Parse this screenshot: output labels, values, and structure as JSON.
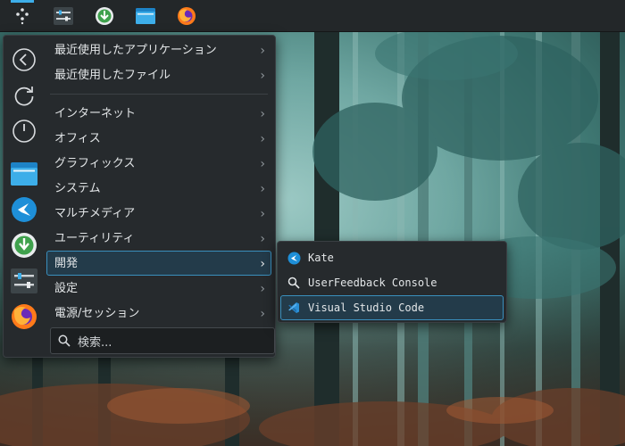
{
  "panel": {
    "buttons": [
      {
        "icon": "application-launcher-icon",
        "active": true
      },
      {
        "icon": "system-settings-icon"
      },
      {
        "icon": "download-manager-icon"
      },
      {
        "icon": "file-manager-icon"
      },
      {
        "icon": "firefox-icon"
      }
    ]
  },
  "sidebar": {
    "items": [
      {
        "icon": "back-icon"
      },
      {
        "icon": "reboot-icon"
      },
      {
        "icon": "shutdown-icon"
      },
      {
        "icon": "file-manager-icon"
      },
      {
        "icon": "kate-icon"
      },
      {
        "icon": "download-icon"
      },
      {
        "icon": "system-settings-icon"
      },
      {
        "icon": "firefox-icon"
      }
    ]
  },
  "categories": {
    "recent": [
      {
        "label": "最近使用したアプリケーション"
      },
      {
        "label": "最近使用したファイル"
      }
    ],
    "items": [
      {
        "label": "インターネット"
      },
      {
        "label": "オフィス"
      },
      {
        "label": "グラフィックス"
      },
      {
        "label": "システム"
      },
      {
        "label": "マルチメディア"
      },
      {
        "label": "ユーティリティ"
      },
      {
        "label": "開発",
        "selected": true
      },
      {
        "label": "設定"
      },
      {
        "label": "電源/セッション"
      }
    ],
    "chevron": "›"
  },
  "search": {
    "placeholder": "検索..."
  },
  "submenu": {
    "items": [
      {
        "label": "Kate",
        "icon": "kate-icon"
      },
      {
        "label": "UserFeedback Console",
        "icon": "search-icon"
      },
      {
        "label": "Visual Studio Code",
        "icon": "vscode-icon",
        "selected": true
      }
    ]
  },
  "colors": {
    "accent": "#3daee9",
    "selection_bg": "#233b4a",
    "menu_bg": "#262a2d",
    "panel_bg": "#232729"
  }
}
